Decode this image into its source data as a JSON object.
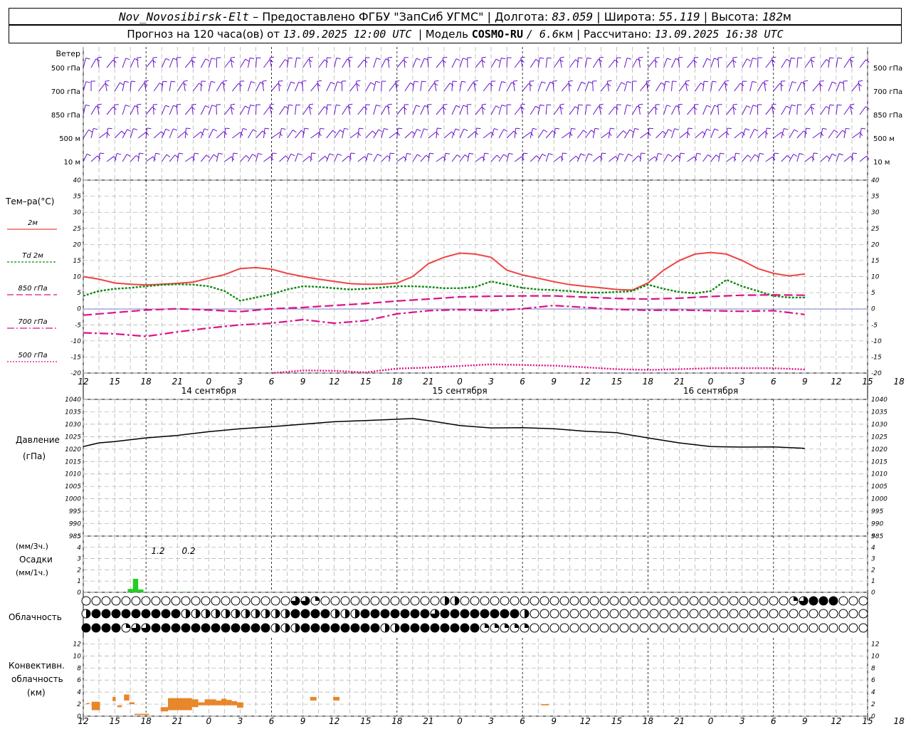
{
  "header": {
    "station": "Nov_Novosibirsk-Elt",
    "provided": "– Предоставлено ФГБУ \"ЗапСиб УГМС\" |",
    "lon_label": "Долгота:",
    "lon": "83.059",
    "lat_label": "| Широта:",
    "lat": "55.119",
    "alt_label": "| Высота:",
    "alt": "182",
    "alt_unit": "м",
    "forecast_label": "Прогноз на 120 часа(ов) от",
    "forecast_from": "13.09.2025 12:00 UTC",
    "model_label": "| Модель",
    "model_name": "COSMO-RU",
    "model_res": "/ 6.6",
    "model_res_unit": "км |",
    "calc_label": "Рассчитано:",
    "calc_time": "13.09.2025 16:38 UTC"
  },
  "colors": {
    "t2m": "#ee4444",
    "td2m": "#118811",
    "t850": "#dd1188",
    "t700": "#dd1188",
    "t500": "#dd1188",
    "pressure": "#000000",
    "wind": "#6611cc",
    "precip": "#22cc22",
    "convective": "#e8862a"
  },
  "panels": {
    "wind": {
      "title": "Ветер",
      "levels": [
        "500 гПа",
        "700 гПа",
        "850 гПа",
        "500 м",
        "10 м"
      ]
    },
    "temperature": {
      "title": "Тем–ра(°С)",
      "legend": [
        {
          "label": "2м",
          "key": "t2m",
          "dash": ""
        },
        {
          "label": "Td 2м",
          "key": "td2m",
          "dash": "3 2"
        },
        {
          "label": "850 гПа",
          "key": "t850",
          "dash": "9 4"
        },
        {
          "label": "700 гПа",
          "key": "t700",
          "dash": "10 3 2 3"
        },
        {
          "label": "500 гПа",
          "key": "t500",
          "dash": "2 2"
        }
      ]
    },
    "pressure": {
      "title1": "Давление",
      "title2": "(гПа)"
    },
    "precip": {
      "unit3h": "(мм/3ч.)",
      "title": "Осадки",
      "unit1h": "(мм/1ч.)",
      "labels": [
        "1.2",
        "0.2"
      ]
    },
    "cloud": {
      "title": "Облачность"
    },
    "convective": {
      "title1": "Конвективн.",
      "title2": "облачность",
      "title3": "(км)"
    }
  },
  "time_axis": {
    "hour_labels": [
      "12",
      "15",
      "18",
      "21",
      "0",
      "3",
      "6",
      "9",
      "12",
      "15",
      "18",
      "21",
      "0",
      "3",
      "6",
      "9",
      "12",
      "15",
      "18",
      "21",
      "0",
      "3",
      "6",
      "9",
      "12",
      "15",
      "18"
    ],
    "date_labels": [
      "14 сентября",
      "15 сентября",
      "16 сентября"
    ]
  },
  "chart_data": [
    {
      "type": "line",
      "name": "temperature",
      "ylim": [
        -20,
        40
      ],
      "yticks": [
        -20,
        -15,
        -10,
        -5,
        0,
        5,
        10,
        15,
        20,
        25,
        30,
        35,
        40
      ],
      "x_hours": [
        0,
        3,
        6,
        9,
        12,
        15,
        18,
        21,
        24,
        27,
        30,
        33,
        36,
        39,
        42,
        45,
        48,
        51,
        54,
        57,
        60,
        63,
        66,
        69,
        72,
        75,
        78
      ],
      "series": [
        {
          "key": "t2m",
          "x": [
            0,
            3,
            6,
            9,
            12,
            15,
            18,
            21,
            24,
            27,
            30,
            33,
            36,
            39,
            42,
            45,
            48,
            51,
            54,
            57,
            60,
            63,
            66,
            69,
            72,
            75,
            78,
            81,
            84,
            87,
            90,
            93,
            96,
            99,
            102,
            105,
            108,
            111,
            114,
            117,
            120,
            123,
            126,
            129,
            132,
            135,
            138,
            141,
            144,
            147,
            150
          ],
          "y": [
            10,
            9.2,
            8,
            7.6,
            7.4,
            7.6,
            7.9,
            8.3,
            9.5,
            10.6,
            12.5,
            12.8,
            12.3,
            11,
            10,
            9.2,
            8.5,
            7.8,
            7.6,
            7.6,
            8,
            10,
            14,
            16,
            17.3,
            17,
            16,
            12,
            10.5,
            9.5,
            8.4,
            7.5,
            7,
            6.5,
            6,
            5.8,
            8,
            12,
            15,
            17,
            17.5,
            17,
            15,
            12.5,
            11,
            10.2,
            10.8,
            null,
            null,
            null,
            null
          ]
        },
        {
          "key": "td2m",
          "x": [
            0,
            3,
            6,
            9,
            12,
            15,
            18,
            21,
            24,
            27,
            30,
            33,
            36,
            39,
            42,
            45,
            48,
            51,
            54,
            57,
            60,
            63,
            66,
            69,
            72,
            75,
            78,
            81,
            84,
            87,
            90,
            93,
            96,
            99,
            102,
            105,
            108,
            111,
            114,
            117,
            120,
            123,
            126,
            129,
            132,
            135,
            138
          ],
          "y": [
            4,
            5.5,
            6.2,
            6.5,
            7,
            7.4,
            7.6,
            7.5,
            7,
            5.5,
            2.5,
            3.5,
            4.5,
            6,
            7,
            6.8,
            6.4,
            6,
            6.2,
            6.6,
            7,
            7,
            6.8,
            6.4,
            6.4,
            6.8,
            8.5,
            7.5,
            6.5,
            6,
            5.8,
            5.5,
            5,
            5,
            5.2,
            5.5,
            7.5,
            6.2,
            5.2,
            4.8,
            5.5,
            9,
            7,
            5.5,
            4,
            3.5,
            3.5
          ]
        },
        {
          "key": "t850",
          "x": [
            0,
            6,
            12,
            18,
            24,
            30,
            36,
            42,
            48,
            54,
            60,
            66,
            72,
            78,
            84,
            90,
            96,
            102,
            108,
            114,
            120,
            126,
            132,
            138
          ],
          "y": [
            -2,
            -1.2,
            -0.4,
            0,
            -0.4,
            -0.9,
            0,
            0.4,
            1,
            1.6,
            2.4,
            3,
            3.7,
            3.9,
            4,
            4,
            3.6,
            3.2,
            3,
            3.3,
            3.8,
            4.2,
            4.3,
            4.2
          ]
        },
        {
          "key": "t700",
          "x": [
            0,
            6,
            12,
            18,
            24,
            30,
            36,
            42,
            48,
            54,
            60,
            66,
            72,
            78,
            84,
            90,
            96,
            102,
            108,
            114,
            120,
            126,
            132,
            138
          ],
          "y": [
            -7.5,
            -7.8,
            -8.6,
            -7.2,
            -6,
            -5,
            -4.5,
            -3.4,
            -4.5,
            -3.7,
            -1.6,
            -0.6,
            -0.3,
            -0.6,
            0,
            1,
            0.4,
            -0.2,
            -0.5,
            -0.4,
            -0.6,
            -0.8,
            -0.6,
            -1.8
          ]
        },
        {
          "key": "t500",
          "x": [
            36,
            42,
            48,
            54,
            60,
            66,
            72,
            78,
            84,
            90,
            96,
            102,
            108,
            114,
            120,
            126,
            132,
            138
          ],
          "y": [
            -20,
            -19.2,
            -19.3,
            -19.8,
            -18.6,
            -18.3,
            -17.8,
            -17.3,
            -17.5,
            -17.7,
            -18.2,
            -18.8,
            -19,
            -18.8,
            -18.5,
            -18.5,
            -18.5,
            -18.9
          ]
        }
      ]
    },
    {
      "type": "line",
      "name": "pressure",
      "ylim": [
        985,
        1040
      ],
      "yticks": [
        985,
        990,
        995,
        1000,
        1005,
        1010,
        1015,
        1020,
        1025,
        1030,
        1035,
        1040
      ],
      "series": [
        {
          "key": "pressure",
          "x": [
            0,
            3,
            6,
            12,
            18,
            24,
            30,
            36,
            42,
            48,
            54,
            60,
            63,
            66,
            72,
            78,
            84,
            90,
            96,
            102,
            108,
            114,
            120,
            126,
            132,
            138
          ],
          "y": [
            1021,
            1022.5,
            1023,
            1024.5,
            1025.5,
            1027,
            1028.2,
            1029,
            1030,
            1031,
            1031.5,
            1032,
            1032.3,
            1031.5,
            1029.5,
            1028.5,
            1028.6,
            1028.2,
            1027.2,
            1026.6,
            1024.5,
            1022.5,
            1021,
            1020.8,
            1020.9,
            1020.3
          ]
        }
      ]
    },
    {
      "type": "bar",
      "name": "precipitation",
      "ylim": [
        0,
        5
      ],
      "yticks": [
        0,
        1,
        2,
        3,
        4,
        5
      ],
      "x": [
        9,
        10,
        11,
        12,
        19
      ],
      "values": [
        0.3,
        1.2,
        0.25,
        0.05,
        0.05
      ]
    },
    {
      "type": "table",
      "name": "cloudiness",
      "rows": [
        "oooooooooooooooooooooeeqoooooooooooohhoooooooooooooooooooooooooooooooooqeFFFoooooooqooooooooooooooooooooooooooooooooooooooooooFooooooqooooooooooooooooooooooooooooooooooooooooooeeq",
        "hFFFFFFFFFhhhhhhhhhhhFFFFhhhFFFFFFFeFFFFFFFFhoooooooooooooooooooooooooooooooooooooooooooooooooooooooooooooooooooooooooooooo",
        "FFFFqeeFFFFFFFFFFFFhhhFFFFFFFFhhFFFFFFFFqqqqqoooooooooooooooooooooooooooooooooooooooooooooooooooooooooooooooooooooooooooooooo"
      ]
    },
    {
      "type": "bar",
      "name": "convective",
      "ylim": [
        0,
        13
      ],
      "yticks": [
        0,
        2,
        4,
        6,
        8,
        10,
        12
      ],
      "bars": [
        [
          0.6,
          1.2,
          2,
          2.2
        ],
        [
          1.6,
          3.2,
          1,
          2.4
        ],
        [
          5.6,
          6.2,
          2.5,
          3.2
        ],
        [
          6.5,
          7.4,
          1.5,
          1.8
        ],
        [
          7.8,
          8.8,
          2.6,
          3.6
        ],
        [
          8.8,
          9.8,
          2,
          2.3
        ],
        [
          9.8,
          12.6,
          0.2,
          0.4
        ],
        [
          14.8,
          16.2,
          0.8,
          1.5
        ],
        [
          16.2,
          20.8,
          1,
          3
        ],
        [
          20.8,
          22,
          1.5,
          2.8
        ],
        [
          22,
          23.2,
          1.8,
          2.3
        ],
        [
          23.2,
          25.4,
          1.8,
          2.8
        ],
        [
          25.4,
          26.4,
          1.8,
          2.6
        ],
        [
          26.4,
          27.4,
          1.8,
          2.9
        ],
        [
          27.4,
          28.4,
          1.8,
          2.7
        ],
        [
          28.4,
          29.4,
          1.8,
          2.5
        ],
        [
          29.4,
          30.6,
          1.4,
          2.3
        ],
        [
          43.4,
          44.6,
          2.6,
          3.2
        ],
        [
          47.8,
          49,
          2.6,
          3.2
        ],
        [
          87.6,
          89,
          1.8,
          2
        ]
      ]
    }
  ]
}
